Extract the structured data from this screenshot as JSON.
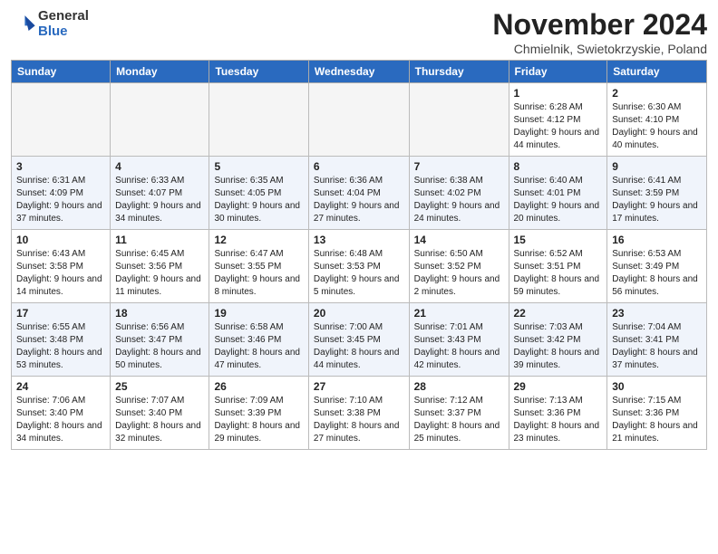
{
  "header": {
    "logo_general": "General",
    "logo_blue": "Blue",
    "month_title": "November 2024",
    "location": "Chmielnik, Swietokrzyskie, Poland"
  },
  "days_of_week": [
    "Sunday",
    "Monday",
    "Tuesday",
    "Wednesday",
    "Thursday",
    "Friday",
    "Saturday"
  ],
  "weeks": [
    [
      {
        "day": "",
        "info": ""
      },
      {
        "day": "",
        "info": ""
      },
      {
        "day": "",
        "info": ""
      },
      {
        "day": "",
        "info": ""
      },
      {
        "day": "",
        "info": ""
      },
      {
        "day": "1",
        "info": "Sunrise: 6:28 AM\nSunset: 4:12 PM\nDaylight: 9 hours and 44 minutes."
      },
      {
        "day": "2",
        "info": "Sunrise: 6:30 AM\nSunset: 4:10 PM\nDaylight: 9 hours and 40 minutes."
      }
    ],
    [
      {
        "day": "3",
        "info": "Sunrise: 6:31 AM\nSunset: 4:09 PM\nDaylight: 9 hours and 37 minutes."
      },
      {
        "day": "4",
        "info": "Sunrise: 6:33 AM\nSunset: 4:07 PM\nDaylight: 9 hours and 34 minutes."
      },
      {
        "day": "5",
        "info": "Sunrise: 6:35 AM\nSunset: 4:05 PM\nDaylight: 9 hours and 30 minutes."
      },
      {
        "day": "6",
        "info": "Sunrise: 6:36 AM\nSunset: 4:04 PM\nDaylight: 9 hours and 27 minutes."
      },
      {
        "day": "7",
        "info": "Sunrise: 6:38 AM\nSunset: 4:02 PM\nDaylight: 9 hours and 24 minutes."
      },
      {
        "day": "8",
        "info": "Sunrise: 6:40 AM\nSunset: 4:01 PM\nDaylight: 9 hours and 20 minutes."
      },
      {
        "day": "9",
        "info": "Sunrise: 6:41 AM\nSunset: 3:59 PM\nDaylight: 9 hours and 17 minutes."
      }
    ],
    [
      {
        "day": "10",
        "info": "Sunrise: 6:43 AM\nSunset: 3:58 PM\nDaylight: 9 hours and 14 minutes."
      },
      {
        "day": "11",
        "info": "Sunrise: 6:45 AM\nSunset: 3:56 PM\nDaylight: 9 hours and 11 minutes."
      },
      {
        "day": "12",
        "info": "Sunrise: 6:47 AM\nSunset: 3:55 PM\nDaylight: 9 hours and 8 minutes."
      },
      {
        "day": "13",
        "info": "Sunrise: 6:48 AM\nSunset: 3:53 PM\nDaylight: 9 hours and 5 minutes."
      },
      {
        "day": "14",
        "info": "Sunrise: 6:50 AM\nSunset: 3:52 PM\nDaylight: 9 hours and 2 minutes."
      },
      {
        "day": "15",
        "info": "Sunrise: 6:52 AM\nSunset: 3:51 PM\nDaylight: 8 hours and 59 minutes."
      },
      {
        "day": "16",
        "info": "Sunrise: 6:53 AM\nSunset: 3:49 PM\nDaylight: 8 hours and 56 minutes."
      }
    ],
    [
      {
        "day": "17",
        "info": "Sunrise: 6:55 AM\nSunset: 3:48 PM\nDaylight: 8 hours and 53 minutes."
      },
      {
        "day": "18",
        "info": "Sunrise: 6:56 AM\nSunset: 3:47 PM\nDaylight: 8 hours and 50 minutes."
      },
      {
        "day": "19",
        "info": "Sunrise: 6:58 AM\nSunset: 3:46 PM\nDaylight: 8 hours and 47 minutes."
      },
      {
        "day": "20",
        "info": "Sunrise: 7:00 AM\nSunset: 3:45 PM\nDaylight: 8 hours and 44 minutes."
      },
      {
        "day": "21",
        "info": "Sunrise: 7:01 AM\nSunset: 3:43 PM\nDaylight: 8 hours and 42 minutes."
      },
      {
        "day": "22",
        "info": "Sunrise: 7:03 AM\nSunset: 3:42 PM\nDaylight: 8 hours and 39 minutes."
      },
      {
        "day": "23",
        "info": "Sunrise: 7:04 AM\nSunset: 3:41 PM\nDaylight: 8 hours and 37 minutes."
      }
    ],
    [
      {
        "day": "24",
        "info": "Sunrise: 7:06 AM\nSunset: 3:40 PM\nDaylight: 8 hours and 34 minutes."
      },
      {
        "day": "25",
        "info": "Sunrise: 7:07 AM\nSunset: 3:40 PM\nDaylight: 8 hours and 32 minutes."
      },
      {
        "day": "26",
        "info": "Sunrise: 7:09 AM\nSunset: 3:39 PM\nDaylight: 8 hours and 29 minutes."
      },
      {
        "day": "27",
        "info": "Sunrise: 7:10 AM\nSunset: 3:38 PM\nDaylight: 8 hours and 27 minutes."
      },
      {
        "day": "28",
        "info": "Sunrise: 7:12 AM\nSunset: 3:37 PM\nDaylight: 8 hours and 25 minutes."
      },
      {
        "day": "29",
        "info": "Sunrise: 7:13 AM\nSunset: 3:36 PM\nDaylight: 8 hours and 23 minutes."
      },
      {
        "day": "30",
        "info": "Sunrise: 7:15 AM\nSunset: 3:36 PM\nDaylight: 8 hours and 21 minutes."
      }
    ]
  ]
}
